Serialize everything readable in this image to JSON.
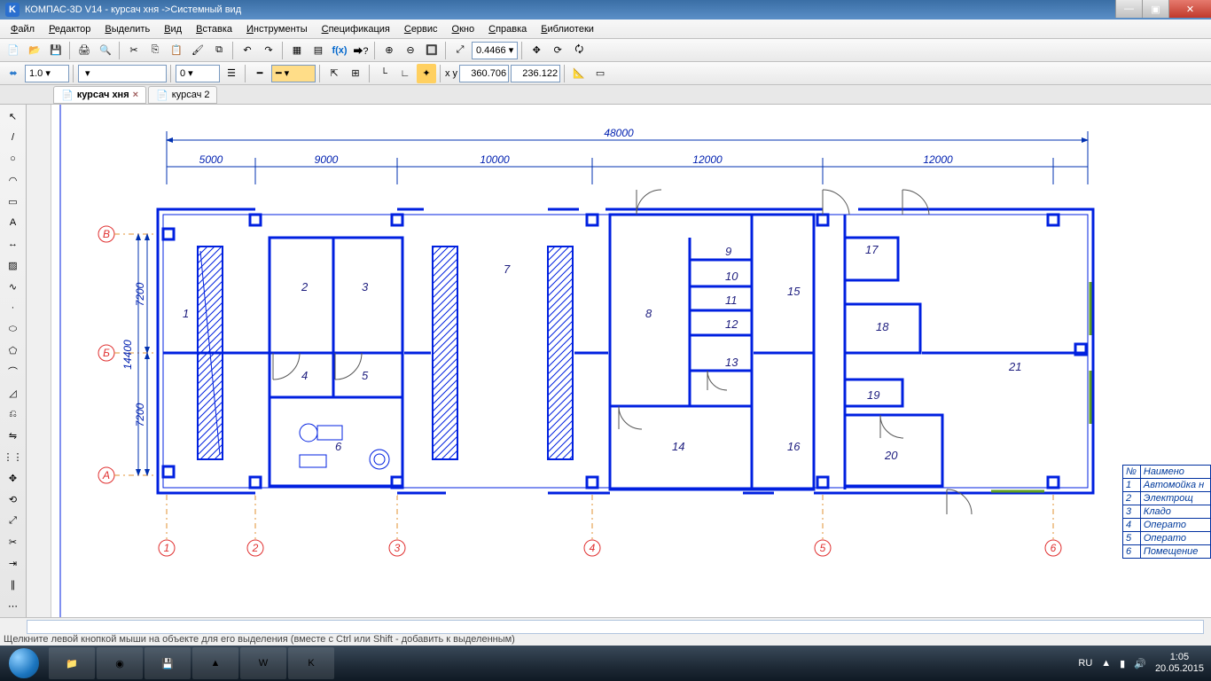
{
  "title": "КОМПАС-3D V14 - курсач хня ->Системный вид",
  "menu": [
    "Файл",
    "Редактор",
    "Выделить",
    "Вид",
    "Вставка",
    "Инструменты",
    "Спецификация",
    "Сервис",
    "Окно",
    "Справка",
    "Библиотеки"
  ],
  "toolbar2": {
    "scale": "1.0",
    "step": "",
    "step2": "0"
  },
  "zoom": "0.4466",
  "coord_x": "360.706",
  "coord_y": "236.122",
  "tabs": [
    {
      "label": "курсач хня",
      "active": true
    },
    {
      "label": "курсач 2",
      "active": false
    }
  ],
  "status_hint": "Щелкните левой кнопкой мыши на объекте для его выделения (вместе с Ctrl или Shift - добавить к выделенным)",
  "tray": {
    "lang": "RU",
    "time": "1:05",
    "date": "20.05.2015"
  },
  "dims": {
    "total": "48000",
    "d1": "5000",
    "d2": "9000",
    "d3": "10000",
    "d4": "12000",
    "d5": "12000",
    "h1": "7200",
    "h2": "7200",
    "htot": "14400"
  },
  "rooms": [
    "1",
    "2",
    "3",
    "4",
    "5",
    "6",
    "7",
    "8",
    "9",
    "10",
    "11",
    "12",
    "13",
    "14",
    "15",
    "16",
    "17",
    "18",
    "19",
    "20",
    "21"
  ],
  "axis_letters": [
    "А",
    "Б",
    "В"
  ],
  "axis_nums": [
    "1",
    "2",
    "3",
    "4",
    "5",
    "6"
  ],
  "legend": [
    {
      "n": "№",
      "t": "Наимено"
    },
    {
      "n": "1",
      "t": "Автомойка н"
    },
    {
      "n": "2",
      "t": "Электрощ"
    },
    {
      "n": "3",
      "t": "Кладо"
    },
    {
      "n": "4",
      "t": "Операто"
    },
    {
      "n": "5",
      "t": "Операто"
    },
    {
      "n": "6",
      "t": "Помещение"
    }
  ]
}
